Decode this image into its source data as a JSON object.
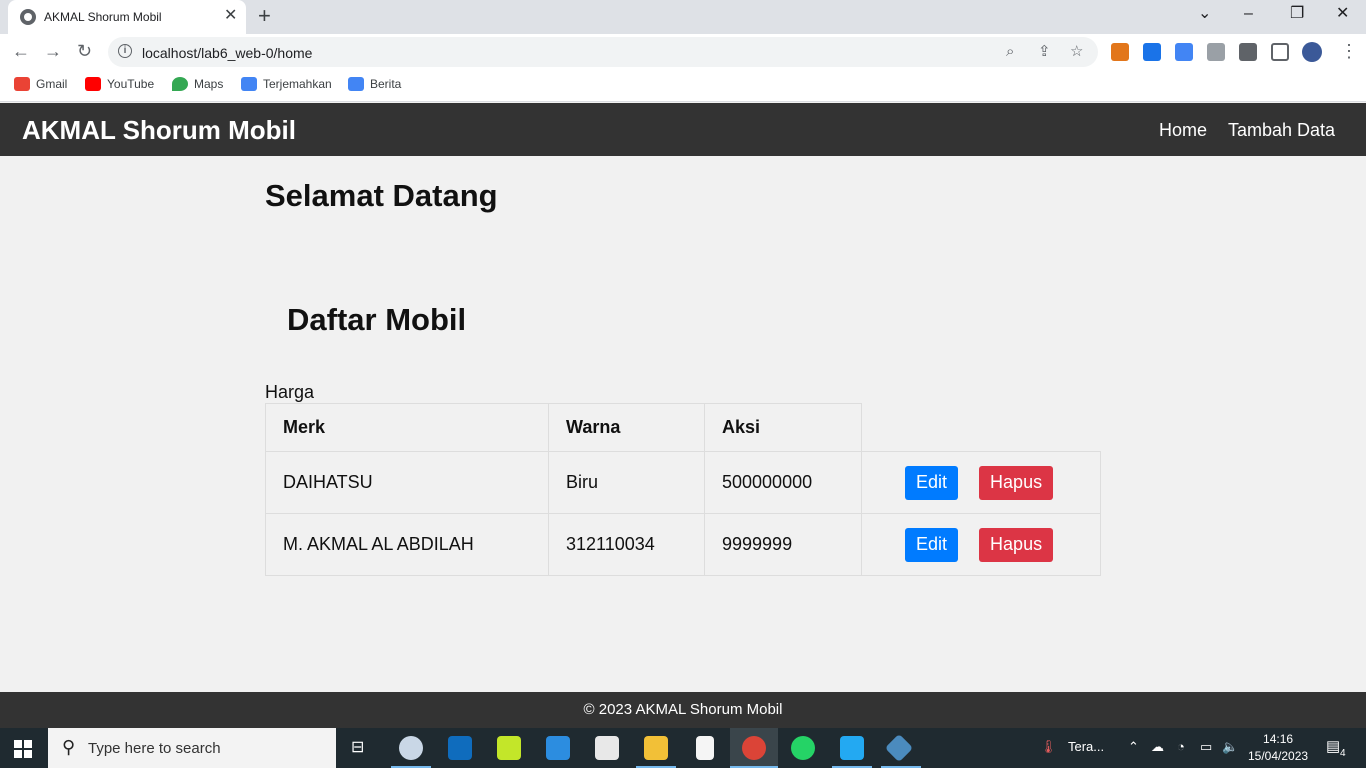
{
  "browser": {
    "tab_title": "AKMAL Shorum Mobil",
    "url": "localhost/lab6_web-0/home",
    "bookmarks": [
      {
        "label": "Gmail",
        "icon": "gmail-icon",
        "color": "#ea4335"
      },
      {
        "label": "YouTube",
        "icon": "youtube-icon",
        "color": "#ff0000"
      },
      {
        "label": "Maps",
        "icon": "maps-icon",
        "color": "#34a853"
      },
      {
        "label": "Terjemahkan",
        "icon": "translate-icon",
        "color": "#4285f4"
      },
      {
        "label": "Berita",
        "icon": "news-icon",
        "color": "#4285f4"
      }
    ]
  },
  "navbar": {
    "brand": "AKMAL Shorum Mobil",
    "links": [
      "Home",
      "Tambah Data"
    ]
  },
  "main": {
    "heading": "Selamat Datang",
    "list_title": "Daftar Mobil",
    "caption": "Harga",
    "table": {
      "headers": [
        "Merk",
        "Warna",
        "Aksi"
      ],
      "rows": [
        {
          "merk": "DAIHATSU",
          "warna": "Biru",
          "harga": "500000000"
        },
        {
          "merk": "M. AKMAL AL ABDILAH",
          "warna": "312110034",
          "harga": "9999999"
        }
      ],
      "edit_label": "Edit",
      "delete_label": "Hapus"
    }
  },
  "footer": {
    "text": "© 2023 AKMAL Shorum Mobil"
  },
  "taskbar": {
    "search_placeholder": "Type here to search",
    "weather": "Tera...",
    "time": "14:16",
    "date": "15/04/2023",
    "notifications": "4"
  },
  "colors": {
    "navbar_bg": "#333333",
    "edit_button": "#007bff",
    "delete_button": "#dc3545"
  }
}
